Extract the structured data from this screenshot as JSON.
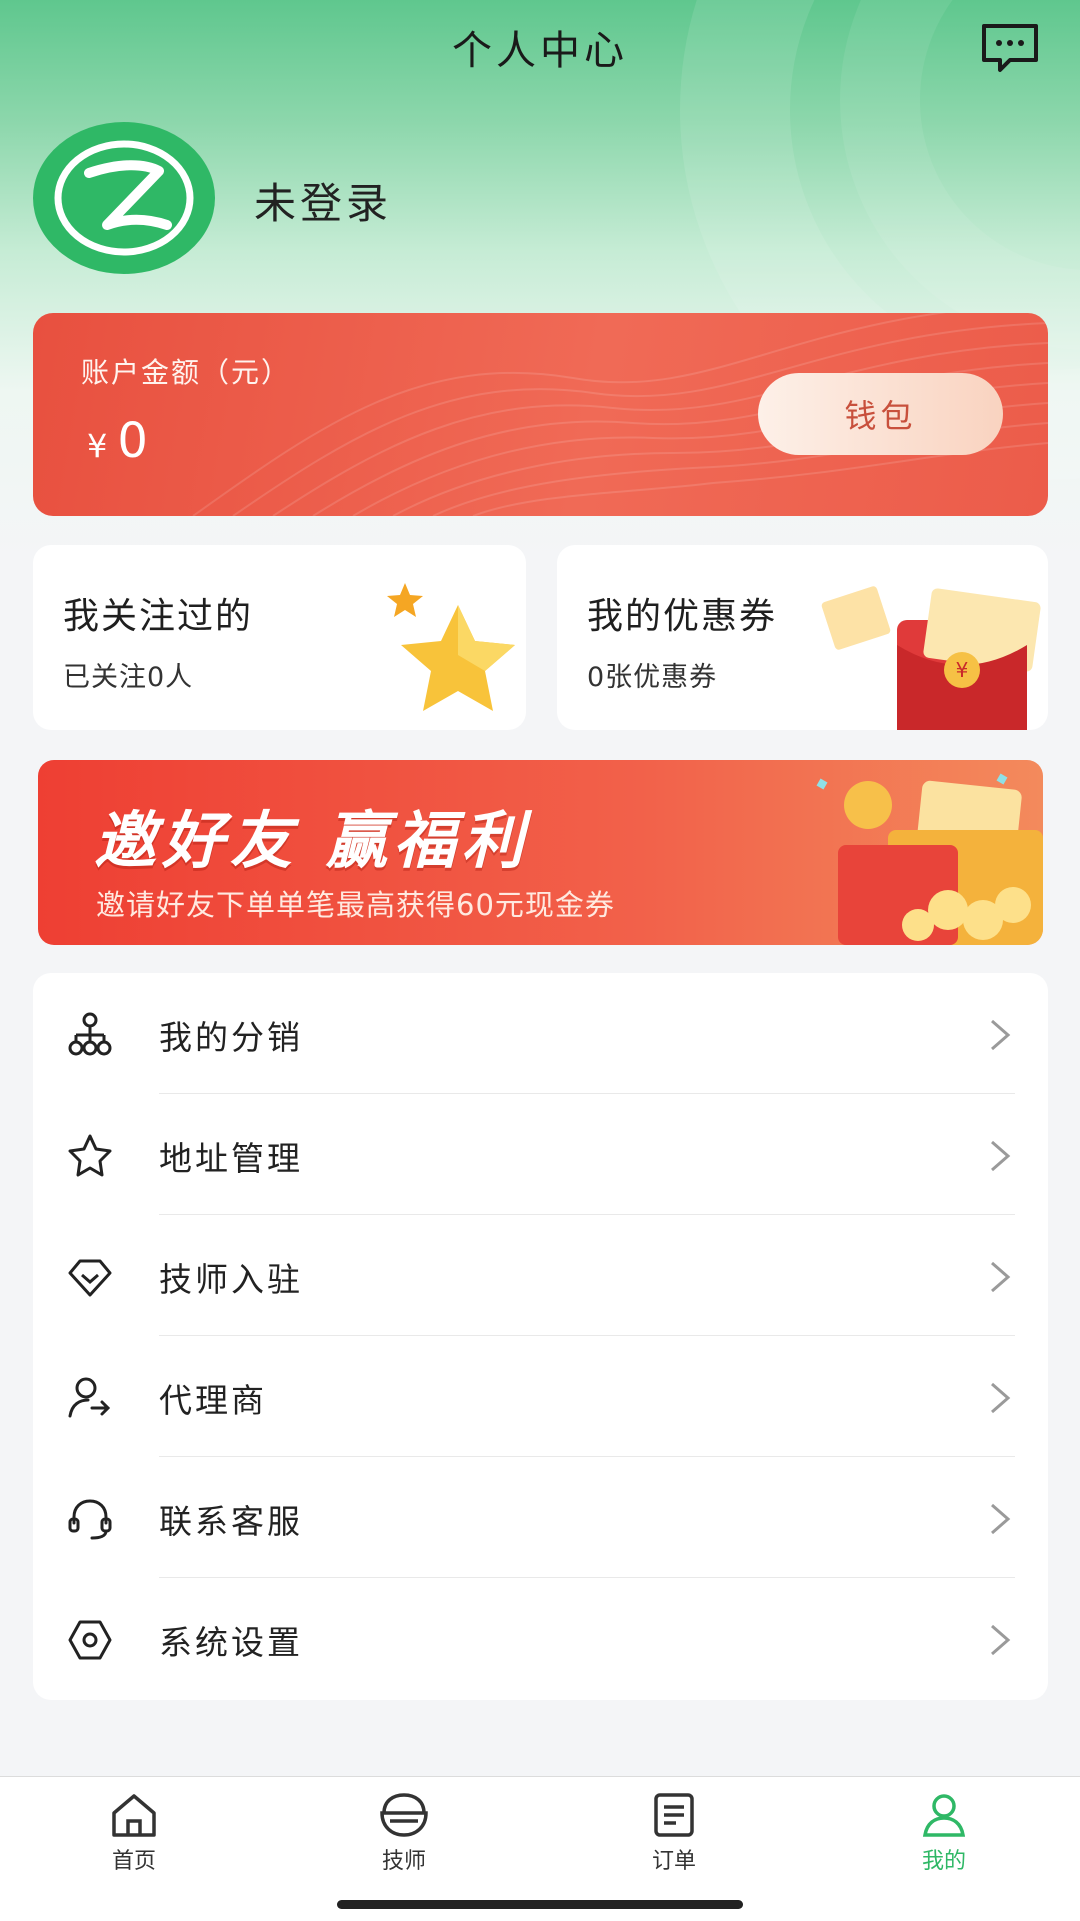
{
  "header": {
    "title": "个人中心",
    "message_icon": "message-dots-icon"
  },
  "profile": {
    "avatar_icon": "logo-avatar-icon",
    "name": "未登录"
  },
  "wallet": {
    "label": "账户金额（元）",
    "currency": "¥",
    "amount": "0",
    "button_label": "钱包"
  },
  "quick_cards": [
    {
      "title": "我关注过的",
      "subtitle": "已关注0人",
      "icon": "star-icon"
    },
    {
      "title": "我的优惠券",
      "subtitle": "0张优惠券",
      "icon": "red-envelope-icon"
    }
  ],
  "banner": {
    "title": "邀好友 赢福利",
    "subtitle": "邀请好友下单单笔最高获得60元现金券"
  },
  "menu": [
    {
      "label": "我的分销",
      "icon": "distribution-icon"
    },
    {
      "label": "地址管理",
      "icon": "star-outline-icon"
    },
    {
      "label": "技师入驻",
      "icon": "diamond-icon"
    },
    {
      "label": "代理商",
      "icon": "agent-icon"
    },
    {
      "label": "联系客服",
      "icon": "headset-icon"
    },
    {
      "label": "系统设置",
      "icon": "settings-icon"
    }
  ],
  "tabbar": {
    "items": [
      {
        "label": "首页",
        "icon": "home-icon"
      },
      {
        "label": "技师",
        "icon": "technician-icon"
      },
      {
        "label": "订单",
        "icon": "order-icon"
      },
      {
        "label": "我的",
        "icon": "user-icon"
      }
    ],
    "active_index": 3
  },
  "colors": {
    "accent": "#2fb866",
    "wallet_red": "#ec5c4a",
    "banner_red": "#ee3f33"
  }
}
